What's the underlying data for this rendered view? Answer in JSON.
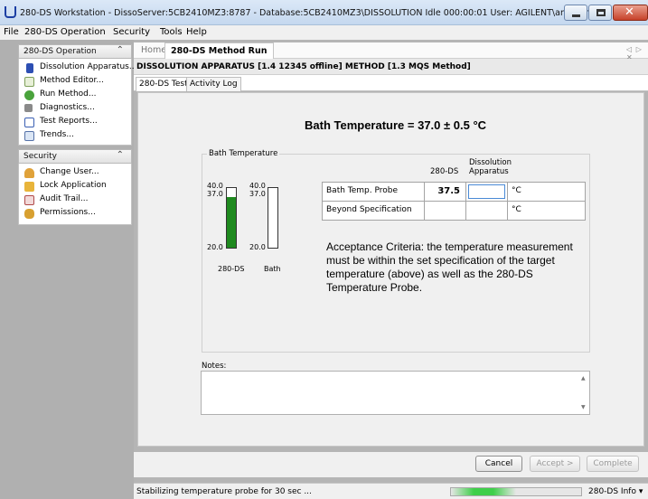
{
  "window": {
    "title": "280-DS Workstation - DissoServer:5CB2410MZ3:8787 - Database:5CB2410MZ3\\DISSOLUTION   Idle 000:00:01  User: AGILENT\\anddamon"
  },
  "menu": [
    "File",
    "280-DS Operation",
    "Security",
    "Tools",
    "Help"
  ],
  "sidebar": {
    "operation": {
      "title": "280-DS Operation",
      "items": [
        {
          "label": "Dissolution Apparatus...",
          "icon": "beaker-icon"
        },
        {
          "label": "Method Editor...",
          "icon": "document-icon"
        },
        {
          "label": "Run Method...",
          "icon": "run-icon"
        },
        {
          "label": "Diagnostics...",
          "icon": "tools-icon"
        },
        {
          "label": "Test Reports...",
          "icon": "report-icon"
        },
        {
          "label": "Trends...",
          "icon": "trend-chart-icon"
        }
      ]
    },
    "security": {
      "title": "Security",
      "items": [
        {
          "label": "Change User...",
          "icon": "user-icon"
        },
        {
          "label": "Lock Application",
          "icon": "lock-icon"
        },
        {
          "label": "Audit Trail...",
          "icon": "audit-icon"
        },
        {
          "label": "Permissions...",
          "icon": "users-icon"
        }
      ]
    }
  },
  "doc_tabs": {
    "home": "Home",
    "active": "280-DS Method Run"
  },
  "header": "DISSOLUTION APPARATUS [1.4 12345 offline] METHOD [1.3 MQS Method]",
  "sub_tabs": {
    "test": "280-DS Test",
    "log": "Activity Log"
  },
  "main": {
    "title": "Bath Temperature = 37.0 ± 0.5 °C",
    "group_label": "Bath Temperature",
    "thermo_280ds": {
      "top": "40.0",
      "value": "37.0",
      "bottom": "20.0",
      "label": "280-DS",
      "reading": "37.5",
      "fill_fraction": 0.85
    },
    "thermo_bath": {
      "top": "40.0",
      "value": "37.0",
      "bottom": "20.0",
      "label": "Bath"
    },
    "table": {
      "col1": "280-DS",
      "col2": "Dissolution Apparatus",
      "rows": [
        {
          "label": "Bath Temp. Probe",
          "value": "37.5",
          "input": "",
          "unit": "°C"
        },
        {
          "label": "Beyond Specification",
          "value": "",
          "input": "",
          "unit": "°C"
        }
      ]
    },
    "criteria": "Acceptance Criteria:  the temperature measurement must be within the set specification of the target temperature (above) as well as the 280-DS Temperature Probe.",
    "notes_label": "Notes:",
    "notes_value": ""
  },
  "buttons": {
    "cancel": "Cancel",
    "accept": "Accept >",
    "complete": "Complete"
  },
  "status": {
    "text": "Stabilizing temperature probe for 30 sec ...",
    "info": "280-DS Info",
    "progress_fraction": 0.5
  },
  "colors": {
    "thermo_fill": "#1f8a1f",
    "progress": "#3fcf4a",
    "title_bar": "#c5d8ef"
  }
}
